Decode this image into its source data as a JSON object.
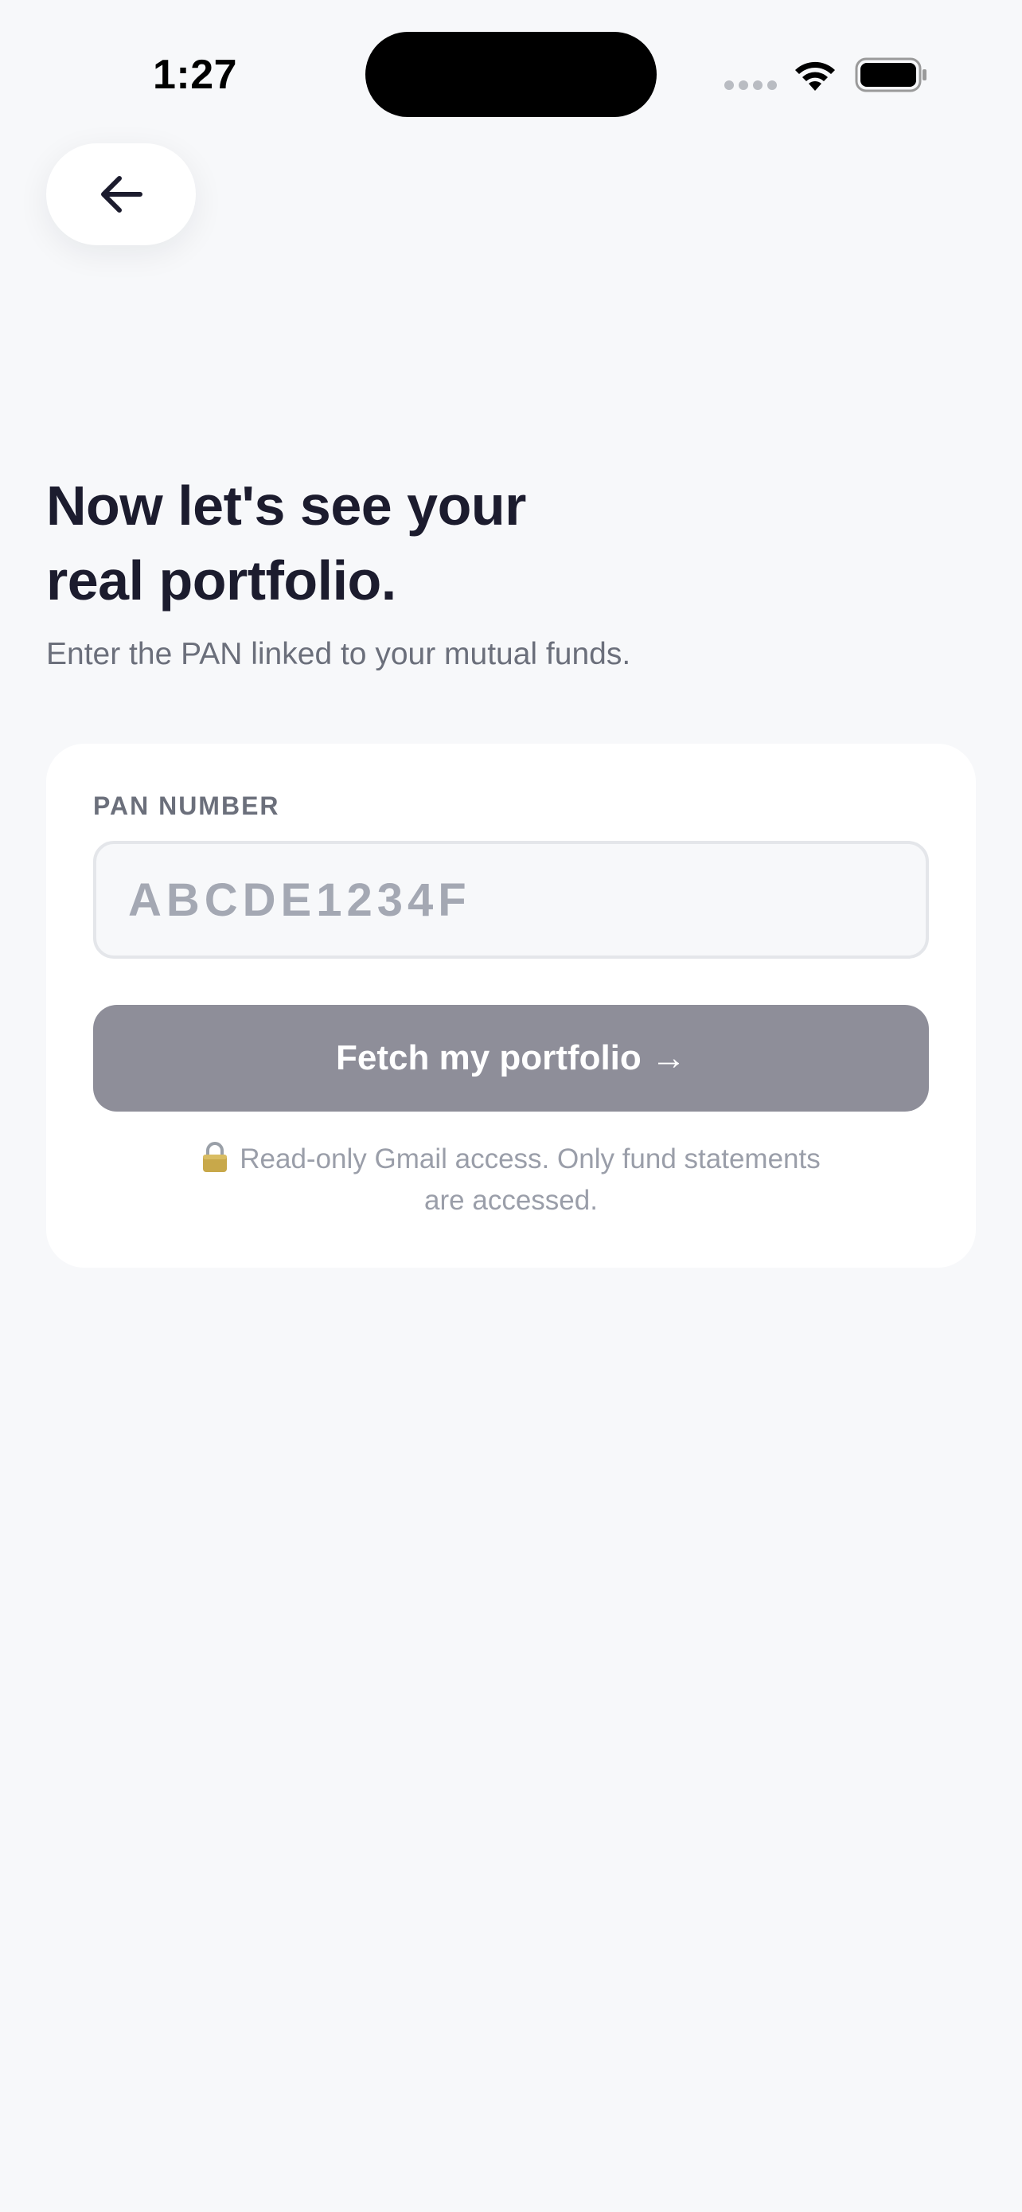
{
  "status_bar": {
    "time": "1:27",
    "icons": [
      "cellular-signal-icon",
      "wifi-icon",
      "battery-icon"
    ]
  },
  "header": {
    "back_icon": "arrow-left-icon"
  },
  "main": {
    "title_line1": "Now let's see your",
    "title_line2": "real portfolio.",
    "subtitle": "Enter the PAN linked to your mutual funds."
  },
  "form": {
    "pan_label": "PAN NUMBER",
    "pan_value": "",
    "pan_placeholder": "ABCDE1234F",
    "submit_label": "Fetch my portfolio →",
    "disclaimer_icon": "lock-icon",
    "disclaimer": "Read-only Gmail access. Only fund statements are accessed."
  },
  "colors": {
    "background": "#f7f8fa",
    "title": "#1c1c2e",
    "muted_text": "#6b6f7b",
    "button_disabled": "#8e8e99",
    "card": "#ffffff"
  }
}
